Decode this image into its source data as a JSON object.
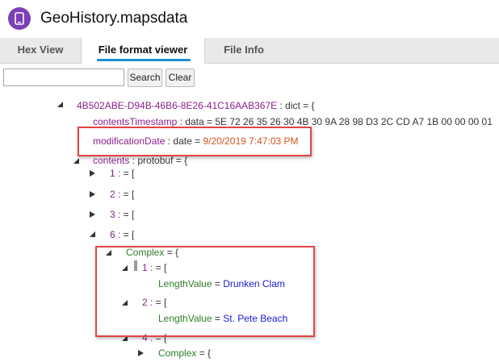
{
  "app": {
    "title": "GeoHistory.mapsdata",
    "icon": "phone-icon",
    "accent_color": "#7b3fb6"
  },
  "tabs": [
    {
      "label": "Hex View",
      "active": false
    },
    {
      "label": "File format viewer",
      "active": true
    },
    {
      "label": "File Info",
      "active": false
    }
  ],
  "search": {
    "value": "",
    "placeholder": "",
    "search_label": "Search",
    "clear_label": "Clear"
  },
  "tree": {
    "root": {
      "key": "4B502ABE-D94B-46B6-8E26-41C16AAB367E",
      "sep": " : dict = {"
    },
    "contents_timestamp": {
      "key": "contentsTimestamp",
      "sep": " : data = ",
      "value": "5E 72 26 35 26 30 4B 30 9A 28 98 D3 2C CD A7 1B 00 00 00 01"
    },
    "modification_date": {
      "key": "modificationDate",
      "sep": " : date = ",
      "value": "9/20/2019 7:47:03 PM"
    },
    "contents": {
      "key": "contents",
      "sep": " : protobuf = {"
    },
    "items": [
      {
        "key": "1 :",
        "sep": " = ["
      },
      {
        "key": "2 :",
        "sep": " = ["
      },
      {
        "key": "3 :",
        "sep": " = ["
      },
      {
        "key": "6 :",
        "sep": " = ["
      }
    ],
    "complex": {
      "label": "Complex",
      "sep": " = {",
      "children": [
        {
          "key": "1 :",
          "sep": " = [",
          "field": "LengthValue",
          "eq": " = ",
          "value": "Drunken Clam"
        },
        {
          "key": "2 :",
          "sep": " = [",
          "field": "LengthValue",
          "eq": " = ",
          "value": "St. Pete Beach"
        }
      ]
    },
    "item4": {
      "key": "4 :",
      "sep": " = ["
    },
    "complex2": {
      "label": "Complex",
      "sep": " = {"
    }
  },
  "highlight_color": "#e24444"
}
